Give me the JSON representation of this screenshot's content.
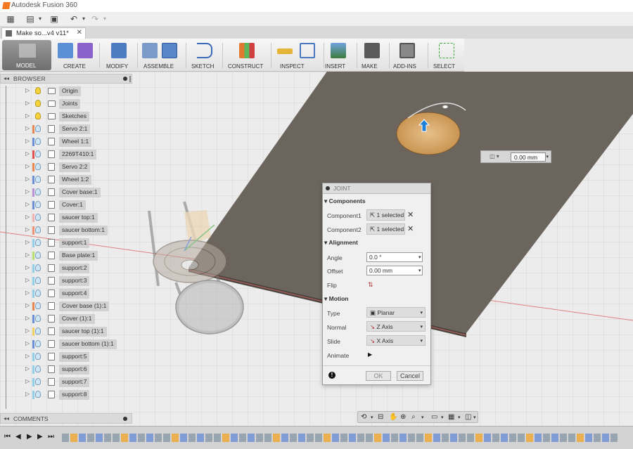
{
  "app": {
    "title": "Autodesk Fusion 360",
    "accent": "#f47a20"
  },
  "document_tab": {
    "name": "Make so...v4 v11*"
  },
  "workspace": {
    "label": "MODEL"
  },
  "toolbar": {
    "groups": [
      "CREATE",
      "MODIFY",
      "ASSEMBLE",
      "SKETCH",
      "CONSTRUCT",
      "INSPECT",
      "INSERT",
      "MAKE",
      "ADD-INS",
      "SELECT"
    ]
  },
  "browser": {
    "title": "BROWSER",
    "items": [
      {
        "label": "Origin",
        "type": "folder",
        "color": ""
      },
      {
        "label": "Joints",
        "type": "folder",
        "color": ""
      },
      {
        "label": "Sketches",
        "type": "folder",
        "color": ""
      },
      {
        "label": "Servo 2:1",
        "type": "component",
        "color": "#e8874f"
      },
      {
        "label": "Wheel 1:1",
        "type": "component",
        "color": "#6a8fd4"
      },
      {
        "label": "2269T410:1",
        "type": "component",
        "color": "#e05050"
      },
      {
        "label": "Servo 2:2",
        "type": "component",
        "color": "#e8874f"
      },
      {
        "label": "Wheel 1:2",
        "type": "component",
        "color": "#6a8fd4"
      },
      {
        "label": "Cover base:1",
        "type": "component",
        "color": "#b890d8"
      },
      {
        "label": "Cover:1",
        "type": "component",
        "color": "#6a8fd4"
      },
      {
        "label": "saucer top:1",
        "type": "component",
        "color": "#f0b0b0"
      },
      {
        "label": "saucer bottom:1",
        "type": "component",
        "color": "#f09070"
      },
      {
        "label": "support:1",
        "type": "component",
        "color": "#8fd0e8"
      },
      {
        "label": "Base plate:1",
        "type": "component",
        "color": "#b8e070"
      },
      {
        "label": "support:2",
        "type": "component",
        "color": "#8fd0e8"
      },
      {
        "label": "support:3",
        "type": "component",
        "color": "#8fd0e8"
      },
      {
        "label": "support:4",
        "type": "component",
        "color": "#8fd0e8"
      },
      {
        "label": "Cover base (1):1",
        "type": "component",
        "color": "#e8874f"
      },
      {
        "label": "Cover (1):1",
        "type": "component",
        "color": "#6a8fd4"
      },
      {
        "label": "saucer top (1):1",
        "type": "component",
        "color": "#f0d060"
      },
      {
        "label": "saucer bottom (1):1",
        "type": "component",
        "color": "#6a8fd4"
      },
      {
        "label": "support:5",
        "type": "component",
        "color": "#8fd0e8"
      },
      {
        "label": "support:6",
        "type": "component",
        "color": "#8fd0e8"
      },
      {
        "label": "support:7",
        "type": "component",
        "color": "#8fd0e8"
      },
      {
        "label": "support:8",
        "type": "component",
        "color": "#8fd0e8"
      }
    ]
  },
  "comments": {
    "title": "COMMENTS"
  },
  "dimension_input": {
    "value": "0.00 mm"
  },
  "joint_dialog": {
    "title": "JOINT",
    "sections": {
      "components": "Components",
      "alignment": "Alignment",
      "motion": "Motion"
    },
    "component1": {
      "label": "Component1",
      "value": "1 selected"
    },
    "component2": {
      "label": "Component2",
      "value": "1 selected"
    },
    "angle": {
      "label": "Angle",
      "value": "0.0 °"
    },
    "offset": {
      "label": "Offset",
      "value": "0.00 mm"
    },
    "flip": {
      "label": "Flip"
    },
    "type": {
      "label": "Type",
      "value": "Planar"
    },
    "normal": {
      "label": "Normal",
      "value": "Z Axis"
    },
    "slide": {
      "label": "Slide",
      "value": "X Axis"
    },
    "animate": {
      "label": "Animate"
    },
    "ok": "OK",
    "cancel": "Cancel"
  }
}
